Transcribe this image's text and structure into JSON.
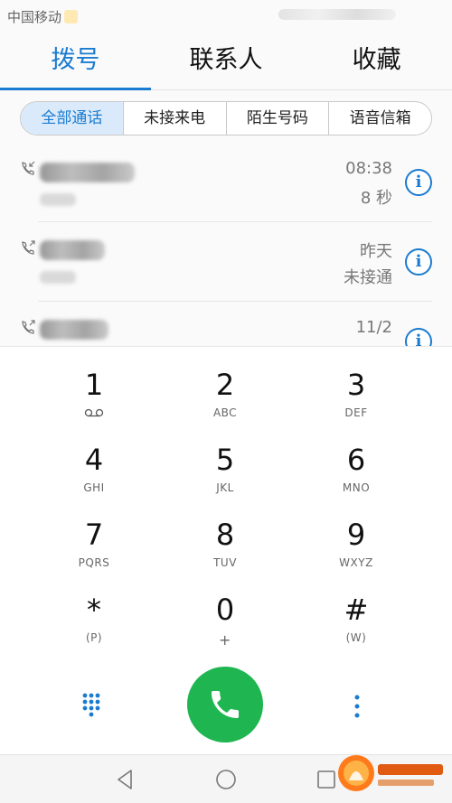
{
  "status_bar": {
    "carrier": "中国移动"
  },
  "tabs": [
    {
      "label": "拨号",
      "active": true
    },
    {
      "label": "联系人",
      "active": false
    },
    {
      "label": "收藏",
      "active": false
    }
  ],
  "filters": [
    {
      "label": "全部通话",
      "selected": true
    },
    {
      "label": "未接来电",
      "selected": false
    },
    {
      "label": "陌生号码",
      "selected": false
    },
    {
      "label": "语音信箱",
      "selected": false
    }
  ],
  "calls": [
    {
      "type": "incoming",
      "time": "08:38",
      "detail": "8 秒"
    },
    {
      "type": "outgoing",
      "time": "昨天",
      "detail": "未接通"
    },
    {
      "type": "outgoing",
      "time": "11/2",
      "detail": ""
    }
  ],
  "keypad": [
    {
      "digit": "1",
      "letters": ""
    },
    {
      "digit": "2",
      "letters": "ABC"
    },
    {
      "digit": "3",
      "letters": "DEF"
    },
    {
      "digit": "4",
      "letters": "GHI"
    },
    {
      "digit": "5",
      "letters": "JKL"
    },
    {
      "digit": "6",
      "letters": "MNO"
    },
    {
      "digit": "7",
      "letters": "PQRS"
    },
    {
      "digit": "8",
      "letters": "TUV"
    },
    {
      "digit": "9",
      "letters": "WXYZ"
    },
    {
      "digit": "*",
      "letters": "(P)"
    },
    {
      "digit": "0",
      "letters": "+"
    },
    {
      "digit": "#",
      "letters": "(W)"
    }
  ],
  "colors": {
    "accent": "#1a7bd1",
    "call_green": "#1fb651",
    "selected_filter_bg": "#dbeafb"
  },
  "icons": {
    "call_button": "phone-icon",
    "dialpad_toggle": "dialpad-grid-icon",
    "more": "more-vertical-icon",
    "info": "info-icon",
    "nav_back": "back-triangle-icon",
    "nav_home": "home-circle-icon",
    "nav_recent": "recent-square-icon"
  }
}
